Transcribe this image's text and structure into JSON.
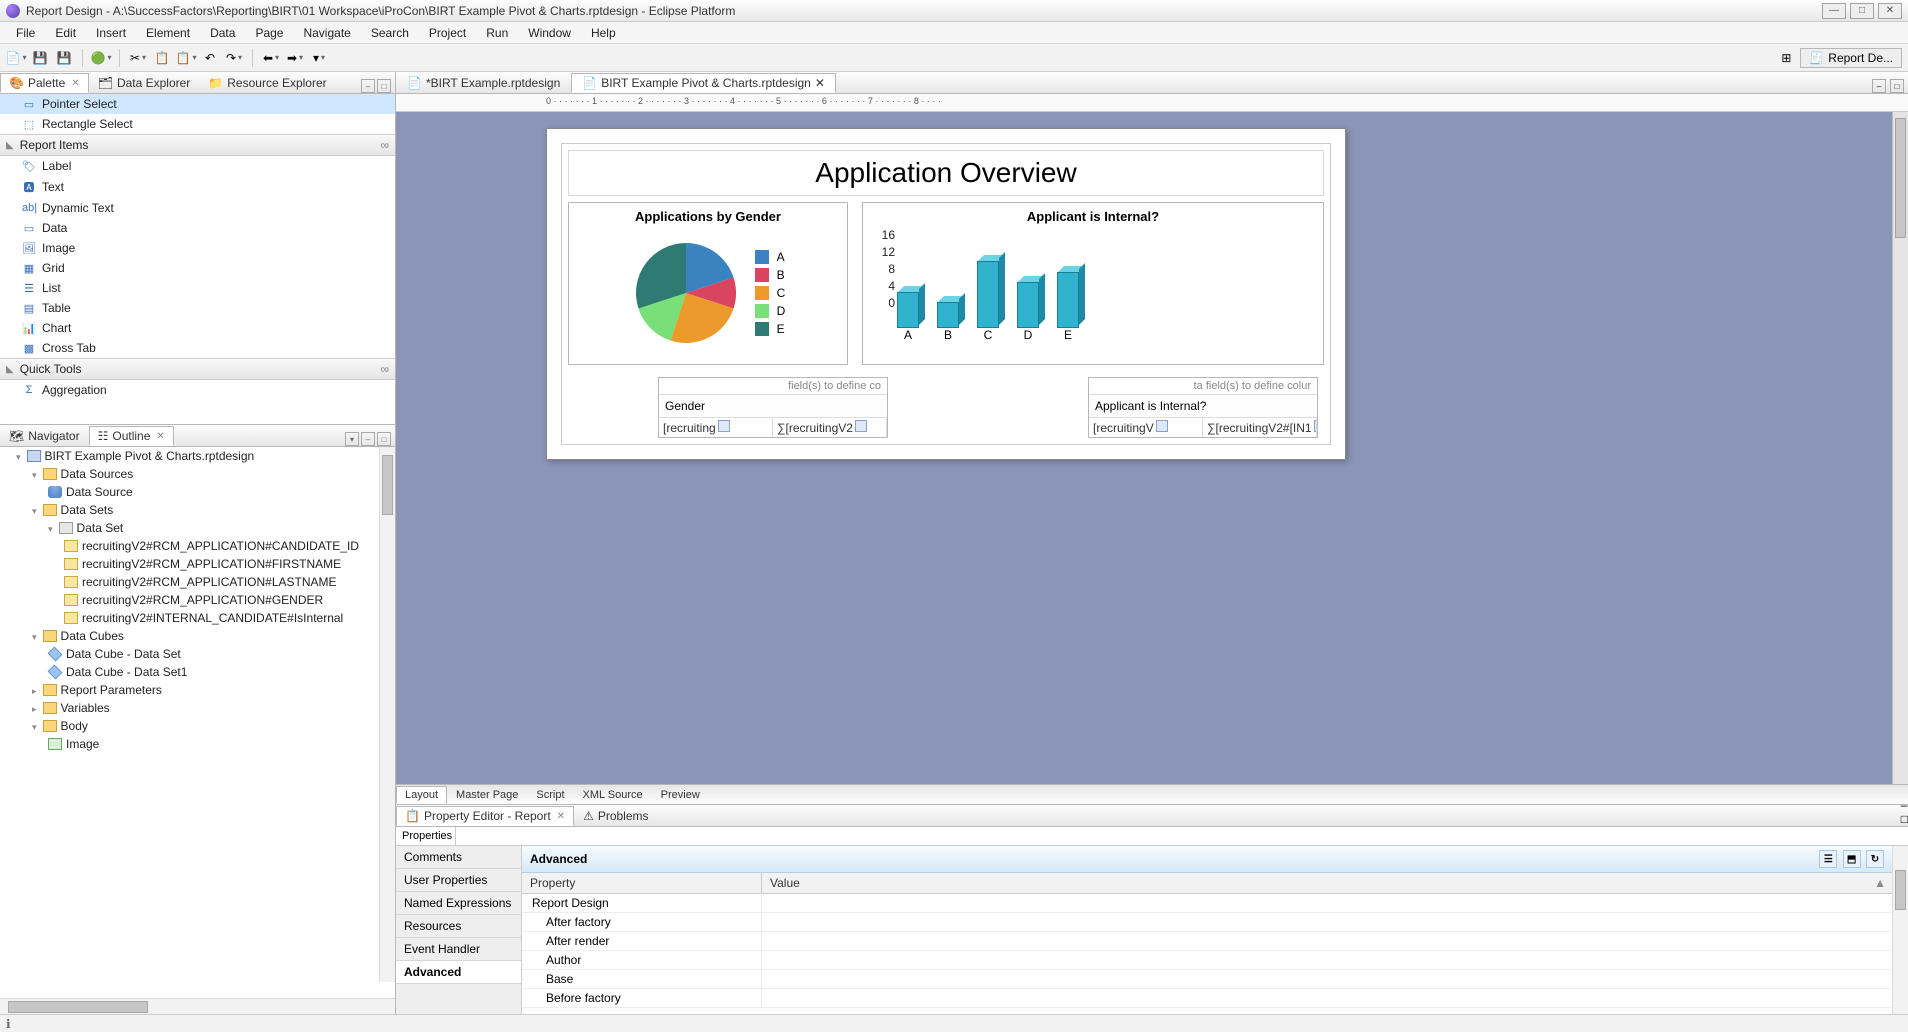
{
  "window": {
    "title": "Report Design - A:\\SuccessFactors\\Reporting\\BIRT\\01 Workspace\\iProCon\\BIRT Example Pivot & Charts.rptdesign - Eclipse Platform"
  },
  "menu": [
    "File",
    "Edit",
    "Insert",
    "Element",
    "Data",
    "Page",
    "Navigate",
    "Search",
    "Project",
    "Run",
    "Window",
    "Help"
  ],
  "perspective_button": "Report De...",
  "left_tabs": {
    "palette": "Palette",
    "data_explorer": "Data Explorer",
    "resource_explorer": "Resource Explorer"
  },
  "palette": {
    "select_tools": {
      "pointer": "Pointer Select",
      "rectangle": "Rectangle Select"
    },
    "report_items_header": "Report Items",
    "report_items": [
      "Label",
      "Text",
      "Dynamic Text",
      "Data",
      "Image",
      "Grid",
      "List",
      "Table",
      "Chart",
      "Cross Tab"
    ],
    "quick_tools_header": "Quick Tools",
    "quick_tools": [
      "Aggregation"
    ]
  },
  "navigator_tabs": {
    "navigator": "Navigator",
    "outline": "Outline"
  },
  "outline": {
    "root": "BIRT Example Pivot & Charts.rptdesign",
    "data_sources": "Data Sources",
    "data_source": "Data Source",
    "data_sets": "Data Sets",
    "data_set": "Data Set",
    "columns": [
      "recruitingV2#RCM_APPLICATION#CANDIDATE_ID",
      "recruitingV2#RCM_APPLICATION#FIRSTNAME",
      "recruitingV2#RCM_APPLICATION#LASTNAME",
      "recruitingV2#RCM_APPLICATION#GENDER",
      "recruitingV2#INTERNAL_CANDIDATE#IsInternal"
    ],
    "data_cubes": "Data Cubes",
    "cubes": [
      "Data Cube - Data Set",
      "Data Cube - Data Set1"
    ],
    "report_params": "Report Parameters",
    "variables": "Variables",
    "body": "Body",
    "body_items": [
      "Image"
    ]
  },
  "editor_tabs": {
    "t1": "*BIRT Example.rptdesign",
    "t2": "BIRT Example Pivot & Charts.rptdesign"
  },
  "report": {
    "title": "Application Overview",
    "chart1_title": "Applications by Gender",
    "chart2_title": "Applicant is Internal?",
    "pivot1_hint": "field(s) to define co",
    "pivot1_header": "Gender",
    "pivot1_b1": "[recruiting",
    "pivot1_b2": "∑[recruitingV2",
    "pivot2_hint": "ta field(s) to define colur",
    "pivot2_header": "Applicant is Internal?",
    "pivot2_b1": "[recruitingV",
    "pivot2_b2": "∑[recruitingV2#[IN1"
  },
  "bottom_editor_tabs": [
    "Layout",
    "Master Page",
    "Script",
    "XML Source",
    "Preview"
  ],
  "prop_view": {
    "tab_active": "Property Editor - Report",
    "tab_other": "Problems",
    "sub": "Properties",
    "cats": [
      "Comments",
      "User Properties",
      "Named Expressions",
      "Resources",
      "Event Handler",
      "Advanced"
    ],
    "grid_title": "Advanced",
    "col_prop": "Property",
    "col_val": "Value",
    "rows": [
      "Report Design",
      "After factory",
      "After render",
      "Author",
      "Base",
      "Before factory"
    ]
  },
  "chart_data": [
    {
      "type": "pie",
      "title": "Applications by Gender",
      "categories": [
        "A",
        "B",
        "C",
        "D",
        "E"
      ],
      "values": [
        20,
        10,
        25,
        15,
        30
      ],
      "colors": [
        "#3b83c0",
        "#d9455f",
        "#ed9a2d",
        "#79e079",
        "#2f7a72"
      ]
    },
    {
      "type": "bar",
      "title": "Applicant is Internal?",
      "categories": [
        "A",
        "B",
        "C",
        "D",
        "E"
      ],
      "values": [
        7,
        5,
        13,
        9,
        11
      ],
      "ylim": [
        0,
        16
      ],
      "yticks": [
        0,
        4,
        8,
        12,
        16
      ],
      "color": "#2fb3cf"
    }
  ]
}
